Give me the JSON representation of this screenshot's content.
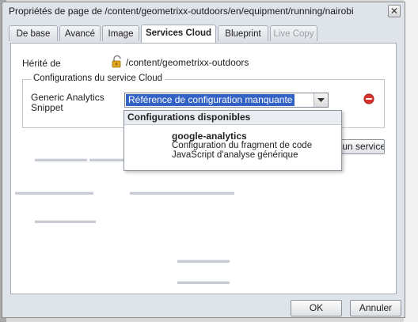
{
  "dialog": {
    "title": "Propriétés de page de /content/geometrixx-outdoors/en/equipment/running/nairobi",
    "close_label": "✕"
  },
  "tabs": [
    {
      "label": "De base",
      "active": false,
      "disabled": false
    },
    {
      "label": "Avancé",
      "active": false,
      "disabled": false
    },
    {
      "label": "Image",
      "active": false,
      "disabled": false
    },
    {
      "label": "Services Cloud",
      "active": true,
      "disabled": false
    },
    {
      "label": "Blueprint",
      "active": false,
      "disabled": false
    },
    {
      "label": "Live Copy",
      "active": false,
      "disabled": true
    }
  ],
  "inherited": {
    "label": "Hérité de",
    "path": "/content/geometrixx-outdoors"
  },
  "cloud_config": {
    "legend": "Configurations du service Cloud",
    "field_label": "Generic Analytics Snippet",
    "combo_value": "Référence de configuration manquante",
    "add_button_label": "r un service"
  },
  "dropdown": {
    "header": "Configurations disponibles",
    "item_name": "google-analytics",
    "item_desc_line1": "Configuration du fragment de code",
    "item_desc_line2": "JavaScript d'analyse générique"
  },
  "footer": {
    "ok_label": "OK",
    "cancel_label": "Annuler"
  },
  "colors": {
    "selection": "#3262c6",
    "remove": "#d9342b"
  }
}
